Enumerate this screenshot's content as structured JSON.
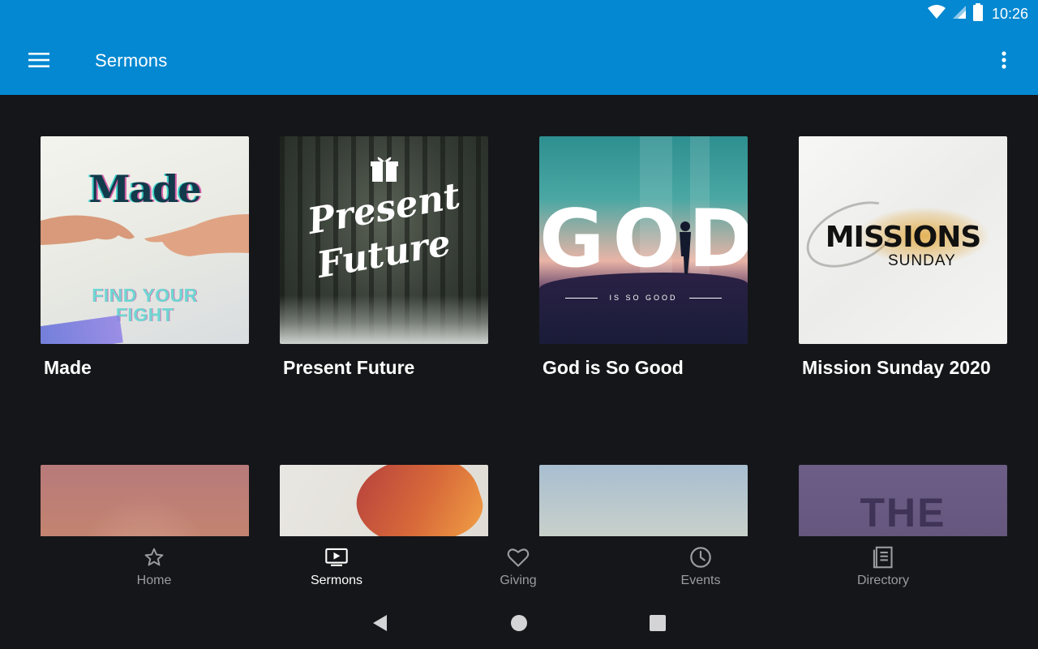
{
  "status_bar": {
    "time": "10:26",
    "icons": [
      "wifi-icon",
      "signal-icon",
      "battery-icon"
    ]
  },
  "app_bar": {
    "title": "Sermons",
    "menu_icon": "hamburger-menu-icon",
    "more_icon": "more-vert-icon",
    "background": "#0488d1"
  },
  "sermons": [
    {
      "title": "Made",
      "artwork": {
        "line1": "Made",
        "line2": "FIND YOUR",
        "line3": "FIGHT"
      }
    },
    {
      "title": "Present Future",
      "artwork": {
        "line1": "Present",
        "line2": "Future"
      }
    },
    {
      "title": "God is So Good",
      "artwork": {
        "line1": "GOD",
        "line2": "IS SO GOOD"
      }
    },
    {
      "title": "Mission Sunday 2020",
      "artwork": {
        "line1": "MISSIONS",
        "line2": "SUNDAY"
      }
    }
  ],
  "sermons_row2": [
    {
      "artwork_text": ""
    },
    {
      "artwork_text": ""
    },
    {
      "artwork_text": ""
    },
    {
      "artwork_text": "THE COST"
    }
  ],
  "bottom_nav": {
    "active": "Sermons",
    "items": [
      {
        "label": "Home",
        "icon": "star-icon"
      },
      {
        "label": "Sermons",
        "icon": "video-play-icon"
      },
      {
        "label": "Giving",
        "icon": "heart-icon"
      },
      {
        "label": "Events",
        "icon": "clock-icon"
      },
      {
        "label": "Directory",
        "icon": "directory-book-icon"
      }
    ]
  },
  "system_nav": {
    "icons": [
      "back-icon",
      "home-icon",
      "recents-icon"
    ]
  }
}
